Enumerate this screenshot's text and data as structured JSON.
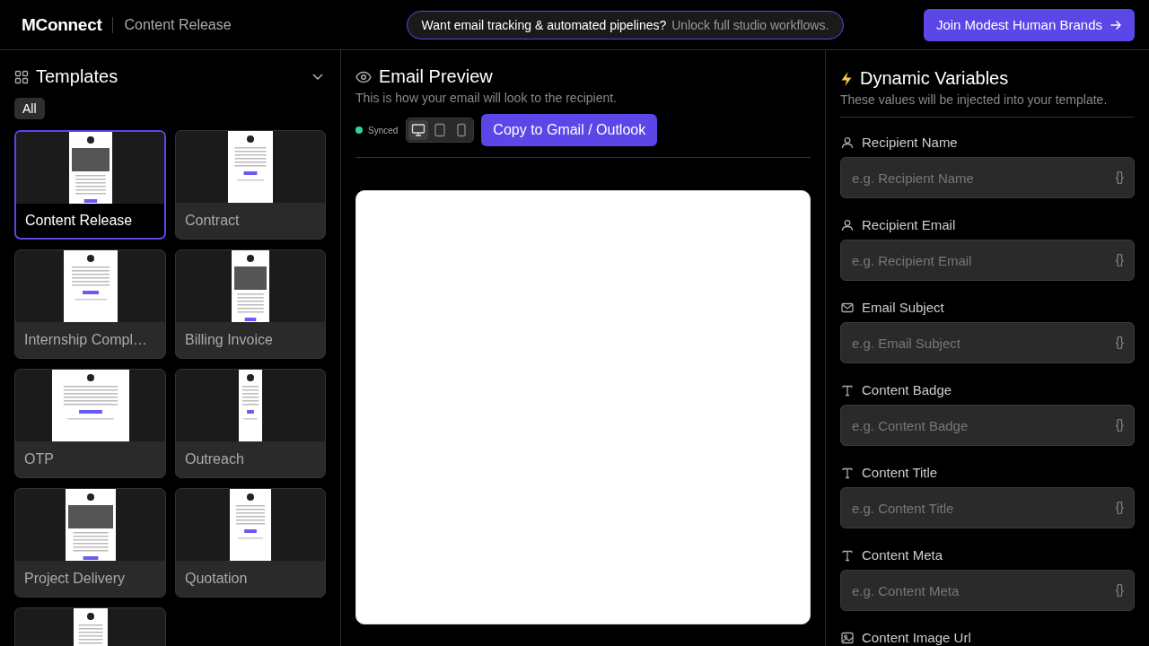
{
  "header": {
    "logo": "MConnect",
    "page_title": "Content Release",
    "promo": {
      "text": "Want email tracking & automated pipelines?",
      "link": "Unlock full studio workflows."
    },
    "cta": "Join Modest Human Brands"
  },
  "templates": {
    "title": "Templates",
    "expanded": true,
    "filters": [
      {
        "label": "All",
        "selected": true
      }
    ],
    "items": [
      {
        "label": "Content Release",
        "selected": true
      },
      {
        "label": "Contract",
        "selected": false
      },
      {
        "label": "Internship Compl…",
        "selected": false
      },
      {
        "label": "Billing Invoice",
        "selected": false
      },
      {
        "label": "OTP",
        "selected": false
      },
      {
        "label": "Outreach",
        "selected": false
      },
      {
        "label": "Project Delivery",
        "selected": false
      },
      {
        "label": "Quotation",
        "selected": false
      },
      {
        "selected": false
      }
    ]
  },
  "preview": {
    "title": "Email Preview",
    "subtitle": "This is how your email will look to the recipient.",
    "sync_status": "Synced",
    "devices": [
      {
        "kind": "desktop",
        "selected": true
      },
      {
        "kind": "tablet",
        "selected": false
      },
      {
        "kind": "phone",
        "selected": false
      }
    ],
    "copy_button": "Copy to Gmail / Outlook"
  },
  "variables": {
    "title": "Dynamic Variables",
    "subtitle": "These values will be injected into your template.",
    "fields": [
      {
        "kind": "person",
        "label": "Recipient Name",
        "placeholder": "e.g. Recipient Name",
        "token": "{}"
      },
      {
        "kind": "person",
        "label": "Recipient Email",
        "placeholder": "e.g. Recipient Email",
        "token": "{}"
      },
      {
        "kind": "mail",
        "label": "Email Subject",
        "placeholder": "e.g. Email Subject",
        "token": "{}"
      },
      {
        "kind": "text",
        "label": "Content Badge",
        "placeholder": "e.g. Content Badge",
        "token": "{}"
      },
      {
        "kind": "text",
        "label": "Content Title",
        "placeholder": "e.g. Content Title",
        "token": "{}"
      },
      {
        "kind": "text",
        "label": "Content Meta",
        "placeholder": "e.g. Content Meta",
        "token": "{}"
      },
      {
        "kind": "image",
        "label": "Content Image Url"
      }
    ]
  }
}
